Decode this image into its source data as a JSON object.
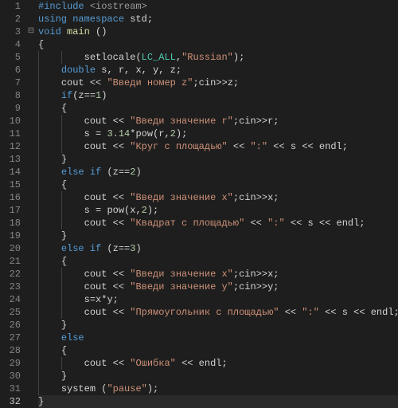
{
  "editor": {
    "current_line": 32,
    "fold_marker_line": 3,
    "fold_marker": "⊟",
    "lines": [
      {
        "n": 1,
        "i": 0,
        "tokens": [
          [
            "k",
            "#include "
          ],
          [
            "inc",
            "<iostream>"
          ]
        ]
      },
      {
        "n": 2,
        "i": 0,
        "tokens": [
          [
            "k",
            "using namespace"
          ],
          [
            "p",
            " "
          ],
          [
            "id",
            "std"
          ],
          [
            "p",
            ";"
          ]
        ]
      },
      {
        "n": 3,
        "i": 0,
        "tokens": [
          [
            "t",
            "void"
          ],
          [
            "p",
            " "
          ],
          [
            "fn",
            "main"
          ],
          [
            "p",
            " ()"
          ]
        ]
      },
      {
        "n": 4,
        "i": 0,
        "tokens": [
          [
            "p",
            "{"
          ]
        ]
      },
      {
        "n": 5,
        "i": 2,
        "tokens": [
          [
            "id",
            "setlocale"
          ],
          [
            "p",
            "("
          ],
          [
            "m",
            "LC_ALL"
          ],
          [
            "p",
            ","
          ],
          [
            "s",
            "\"Russian\""
          ],
          [
            "p",
            ");"
          ]
        ]
      },
      {
        "n": 6,
        "i": 1,
        "tokens": [
          [
            "t",
            "double"
          ],
          [
            "p",
            " "
          ],
          [
            "id",
            "s"
          ],
          [
            "p",
            ", "
          ],
          [
            "id",
            "r"
          ],
          [
            "p",
            ", "
          ],
          [
            "id",
            "x"
          ],
          [
            "p",
            ", "
          ],
          [
            "id",
            "y"
          ],
          [
            "p",
            ", "
          ],
          [
            "id",
            "z"
          ],
          [
            "p",
            ";"
          ]
        ]
      },
      {
        "n": 7,
        "i": 1,
        "tokens": [
          [
            "id",
            "cout"
          ],
          [
            "p",
            " "
          ],
          [
            "op",
            "<<"
          ],
          [
            "p",
            " "
          ],
          [
            "s",
            "\"Введи номер z\""
          ],
          [
            "p",
            ";"
          ],
          [
            "id",
            "cin"
          ],
          [
            "op",
            ">>"
          ],
          [
            "id",
            "z"
          ],
          [
            "p",
            ";"
          ]
        ]
      },
      {
        "n": 8,
        "i": 1,
        "tokens": [
          [
            "k",
            "if"
          ],
          [
            "p",
            "("
          ],
          [
            "id",
            "z"
          ],
          [
            "op",
            "=="
          ],
          [
            "n",
            "1"
          ],
          [
            "p",
            ")"
          ]
        ]
      },
      {
        "n": 9,
        "i": 1,
        "tokens": [
          [
            "p",
            "{"
          ]
        ]
      },
      {
        "n": 10,
        "i": 2,
        "tokens": [
          [
            "id",
            "cout"
          ],
          [
            "p",
            " "
          ],
          [
            "op",
            "<<"
          ],
          [
            "p",
            " "
          ],
          [
            "s",
            "\"Введи значение r\""
          ],
          [
            "p",
            ";"
          ],
          [
            "id",
            "cin"
          ],
          [
            "op",
            ">>"
          ],
          [
            "id",
            "r"
          ],
          [
            "p",
            ";"
          ]
        ]
      },
      {
        "n": 11,
        "i": 2,
        "tokens": [
          [
            "id",
            "s"
          ],
          [
            "p",
            " "
          ],
          [
            "op",
            "="
          ],
          [
            "p",
            " "
          ],
          [
            "n",
            "3.14"
          ],
          [
            "op",
            "*"
          ],
          [
            "id",
            "pow"
          ],
          [
            "p",
            "("
          ],
          [
            "id",
            "r"
          ],
          [
            "p",
            ","
          ],
          [
            "n",
            "2"
          ],
          [
            "p",
            ");"
          ]
        ]
      },
      {
        "n": 12,
        "i": 2,
        "tokens": [
          [
            "id",
            "cout"
          ],
          [
            "p",
            " "
          ],
          [
            "op",
            "<<"
          ],
          [
            "p",
            " "
          ],
          [
            "s",
            "\"Круг с площадью\""
          ],
          [
            "p",
            " "
          ],
          [
            "op",
            "<<"
          ],
          [
            "p",
            " "
          ],
          [
            "s",
            "\":\""
          ],
          [
            "p",
            " "
          ],
          [
            "op",
            "<<"
          ],
          [
            "p",
            " "
          ],
          [
            "id",
            "s"
          ],
          [
            "p",
            " "
          ],
          [
            "op",
            "<<"
          ],
          [
            "p",
            " "
          ],
          [
            "id",
            "endl"
          ],
          [
            "p",
            ";"
          ]
        ]
      },
      {
        "n": 13,
        "i": 1,
        "tokens": [
          [
            "p",
            "}"
          ]
        ]
      },
      {
        "n": 14,
        "i": 1,
        "tokens": [
          [
            "k",
            "else if"
          ],
          [
            "p",
            " ("
          ],
          [
            "id",
            "z"
          ],
          [
            "op",
            "=="
          ],
          [
            "n",
            "2"
          ],
          [
            "p",
            ")"
          ]
        ]
      },
      {
        "n": 15,
        "i": 1,
        "tokens": [
          [
            "p",
            "{"
          ]
        ]
      },
      {
        "n": 16,
        "i": 2,
        "tokens": [
          [
            "id",
            "cout"
          ],
          [
            "p",
            " "
          ],
          [
            "op",
            "<<"
          ],
          [
            "p",
            " "
          ],
          [
            "s",
            "\"Введи значение x\""
          ],
          [
            "p",
            ";"
          ],
          [
            "id",
            "cin"
          ],
          [
            "op",
            ">>"
          ],
          [
            "id",
            "x"
          ],
          [
            "p",
            ";"
          ]
        ]
      },
      {
        "n": 17,
        "i": 2,
        "tokens": [
          [
            "id",
            "s"
          ],
          [
            "p",
            " "
          ],
          [
            "op",
            "="
          ],
          [
            "p",
            " "
          ],
          [
            "id",
            "pow"
          ],
          [
            "p",
            "("
          ],
          [
            "id",
            "x"
          ],
          [
            "p",
            ","
          ],
          [
            "n",
            "2"
          ],
          [
            "p",
            ");"
          ]
        ]
      },
      {
        "n": 18,
        "i": 2,
        "tokens": [
          [
            "id",
            "cout"
          ],
          [
            "p",
            " "
          ],
          [
            "op",
            "<<"
          ],
          [
            "p",
            " "
          ],
          [
            "s",
            "\"Квадрат с площадью\""
          ],
          [
            "p",
            " "
          ],
          [
            "op",
            "<<"
          ],
          [
            "p",
            " "
          ],
          [
            "s",
            "\":\""
          ],
          [
            "p",
            " "
          ],
          [
            "op",
            "<<"
          ],
          [
            "p",
            " "
          ],
          [
            "id",
            "s"
          ],
          [
            "p",
            " "
          ],
          [
            "op",
            "<<"
          ],
          [
            "p",
            " "
          ],
          [
            "id",
            "endl"
          ],
          [
            "p",
            ";"
          ]
        ]
      },
      {
        "n": 19,
        "i": 1,
        "tokens": [
          [
            "p",
            "}"
          ]
        ]
      },
      {
        "n": 20,
        "i": 1,
        "tokens": [
          [
            "k",
            "else if"
          ],
          [
            "p",
            " ("
          ],
          [
            "id",
            "z"
          ],
          [
            "op",
            "=="
          ],
          [
            "n",
            "3"
          ],
          [
            "p",
            ")"
          ]
        ]
      },
      {
        "n": 21,
        "i": 1,
        "tokens": [
          [
            "p",
            "{"
          ]
        ]
      },
      {
        "n": 22,
        "i": 2,
        "tokens": [
          [
            "id",
            "cout"
          ],
          [
            "p",
            " "
          ],
          [
            "op",
            "<<"
          ],
          [
            "p",
            " "
          ],
          [
            "s",
            "\"Введи значение x\""
          ],
          [
            "p",
            ";"
          ],
          [
            "id",
            "cin"
          ],
          [
            "op",
            ">>"
          ],
          [
            "id",
            "x"
          ],
          [
            "p",
            ";"
          ]
        ]
      },
      {
        "n": 23,
        "i": 2,
        "tokens": [
          [
            "id",
            "cout"
          ],
          [
            "p",
            " "
          ],
          [
            "op",
            "<<"
          ],
          [
            "p",
            " "
          ],
          [
            "s",
            "\"Введи значение y\""
          ],
          [
            "p",
            ";"
          ],
          [
            "id",
            "cin"
          ],
          [
            "op",
            ">>"
          ],
          [
            "id",
            "y"
          ],
          [
            "p",
            ";"
          ]
        ]
      },
      {
        "n": 24,
        "i": 2,
        "tokens": [
          [
            "id",
            "s"
          ],
          [
            "op",
            "="
          ],
          [
            "id",
            "x"
          ],
          [
            "op",
            "*"
          ],
          [
            "id",
            "y"
          ],
          [
            "p",
            ";"
          ]
        ]
      },
      {
        "n": 25,
        "i": 2,
        "tokens": [
          [
            "id",
            "cout"
          ],
          [
            "p",
            " "
          ],
          [
            "op",
            "<<"
          ],
          [
            "p",
            " "
          ],
          [
            "s",
            "\"Прямоугольник с площадью\""
          ],
          [
            "p",
            " "
          ],
          [
            "op",
            "<<"
          ],
          [
            "p",
            " "
          ],
          [
            "s",
            "\":\""
          ],
          [
            "p",
            " "
          ],
          [
            "op",
            "<<"
          ],
          [
            "p",
            " "
          ],
          [
            "id",
            "s"
          ],
          [
            "p",
            " "
          ],
          [
            "op",
            "<<"
          ],
          [
            "p",
            " "
          ],
          [
            "id",
            "endl"
          ],
          [
            "p",
            ";"
          ]
        ]
      },
      {
        "n": 26,
        "i": 1,
        "tokens": [
          [
            "p",
            "}"
          ]
        ]
      },
      {
        "n": 27,
        "i": 1,
        "tokens": [
          [
            "k",
            "else"
          ]
        ]
      },
      {
        "n": 28,
        "i": 1,
        "tokens": [
          [
            "p",
            "{"
          ]
        ]
      },
      {
        "n": 29,
        "i": 2,
        "tokens": [
          [
            "id",
            "cout"
          ],
          [
            "p",
            " "
          ],
          [
            "op",
            "<<"
          ],
          [
            "p",
            " "
          ],
          [
            "s",
            "\"Ошибка\""
          ],
          [
            "p",
            " "
          ],
          [
            "op",
            "<<"
          ],
          [
            "p",
            " "
          ],
          [
            "id",
            "endl"
          ],
          [
            "p",
            ";"
          ]
        ]
      },
      {
        "n": 30,
        "i": 1,
        "tokens": [
          [
            "p",
            "}"
          ]
        ]
      },
      {
        "n": 31,
        "i": 1,
        "tokens": [
          [
            "id",
            "system"
          ],
          [
            "p",
            " ("
          ],
          [
            "s",
            "\"pause\""
          ],
          [
            "p",
            ");"
          ]
        ]
      },
      {
        "n": 32,
        "i": 0,
        "tokens": [
          [
            "p",
            "}"
          ]
        ]
      }
    ]
  }
}
